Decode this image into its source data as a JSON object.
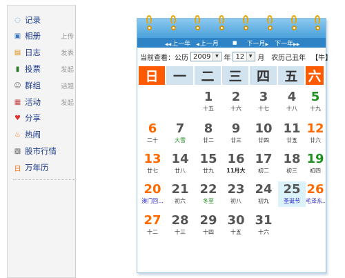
{
  "sidebar": {
    "items": [
      {
        "label": "记录",
        "action": ""
      },
      {
        "label": "相册",
        "action": "上传"
      },
      {
        "label": "日志",
        "action": "发表"
      },
      {
        "label": "投票",
        "action": "发起"
      },
      {
        "label": "群组",
        "action": "话题"
      },
      {
        "label": "活动",
        "action": "发起"
      },
      {
        "label": "分享",
        "action": ""
      },
      {
        "label": "热闹",
        "action": ""
      },
      {
        "label": "股市行情",
        "action": ""
      },
      {
        "label": "万年历",
        "action": ""
      }
    ],
    "icons": [
      "speech-bubble-icon",
      "photo-icon",
      "journal-icon",
      "bar-chart-icon",
      "group-icon",
      "calendar-icon",
      "heart-icon",
      "fire-icon",
      "stock-chart-icon",
      "calendar-date-icon"
    ],
    "icon_glyphs": [
      "◌",
      "▣",
      "▤",
      "▮",
      "☺",
      "▦",
      "♥",
      "♨",
      "▧",
      "日"
    ]
  },
  "calendar": {
    "nav": {
      "prev_year": "上一年",
      "prev_month": "上一月",
      "today": "■",
      "next_month": "下一月",
      "next_year": "下一年"
    },
    "query_label": "当前查看：公历",
    "year": "2009",
    "year_unit": "年",
    "month": "12",
    "month_unit": "月",
    "lunar_text": "农历己丑年",
    "zodiac_text": "【牛】",
    "weekdays": [
      "日",
      "一",
      "二",
      "三",
      "四",
      "五",
      "六"
    ],
    "weeks": [
      [
        {
          "d": "",
          "l": ""
        },
        {
          "d": "",
          "l": ""
        },
        {
          "d": "1",
          "l": "十五"
        },
        {
          "d": "2",
          "l": "十六"
        },
        {
          "d": "3",
          "l": "十七"
        },
        {
          "d": "4",
          "l": "十八"
        },
        {
          "d": "5",
          "l": "十九"
        }
      ],
      [
        {
          "d": "6",
          "l": "二十"
        },
        {
          "d": "7",
          "l": "大雪"
        },
        {
          "d": "8",
          "l": "廿二"
        },
        {
          "d": "9",
          "l": "廿三"
        },
        {
          "d": "10",
          "l": "廿四"
        },
        {
          "d": "11",
          "l": "廿五"
        },
        {
          "d": "12",
          "l": "廿六"
        }
      ],
      [
        {
          "d": "13",
          "l": "廿七"
        },
        {
          "d": "14",
          "l": "廿八"
        },
        {
          "d": "15",
          "l": "廿九"
        },
        {
          "d": "16",
          "l": "11月大"
        },
        {
          "d": "17",
          "l": "初二"
        },
        {
          "d": "18",
          "l": "初三"
        },
        {
          "d": "19",
          "l": "初四"
        }
      ],
      [
        {
          "d": "20",
          "l": "澳门回..."
        },
        {
          "d": "21",
          "l": "初六"
        },
        {
          "d": "22",
          "l": "冬至"
        },
        {
          "d": "23",
          "l": "初八"
        },
        {
          "d": "24",
          "l": "初九"
        },
        {
          "d": "25",
          "l": "圣诞节"
        },
        {
          "d": "26",
          "l": "毛泽东..."
        }
      ],
      [
        {
          "d": "27",
          "l": "十二"
        },
        {
          "d": "28",
          "l": "十三"
        },
        {
          "d": "29",
          "l": "十四"
        },
        {
          "d": "30",
          "l": "十五"
        },
        {
          "d": "31",
          "l": "十六"
        },
        {
          "d": "",
          "l": ""
        },
        {
          "d": "",
          "l": ""
        }
      ]
    ],
    "label_styles": {
      "7": "term",
      "16": "bold",
      "20": "fest",
      "22": "term",
      "25": "fest",
      "26": "fest"
    },
    "green_days": [
      "5",
      "19"
    ],
    "today": "25",
    "colors": {
      "weekend": "#ff6a00",
      "highlight": "#ff5a00",
      "festival": "#1f1fc8",
      "solar_term": "#1f8f1f"
    }
  }
}
